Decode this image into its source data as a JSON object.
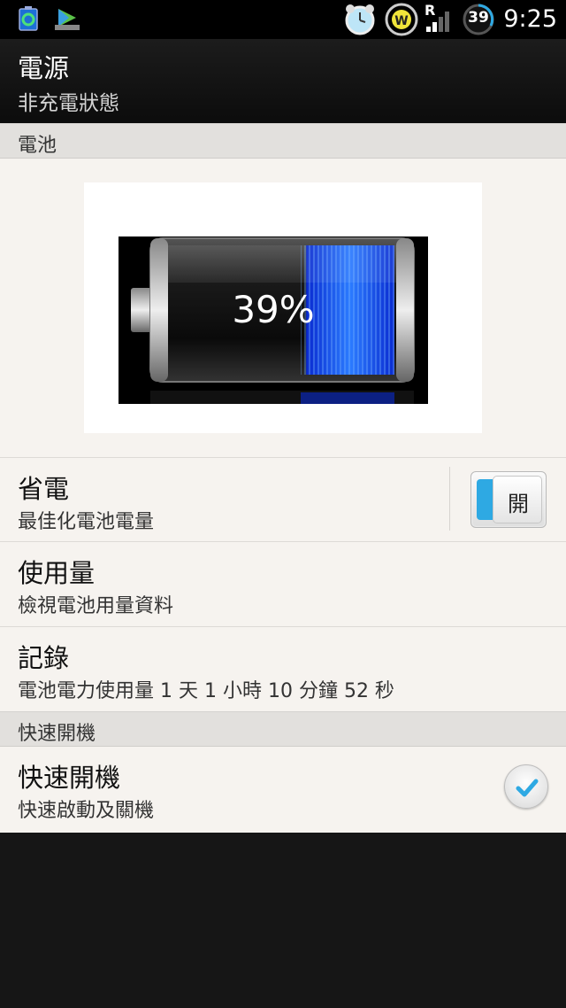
{
  "status_bar": {
    "time": "9:25",
    "network_type": "R",
    "battery_level": "39",
    "icons": [
      "app-recycle-icon",
      "play-store-icon",
      "alarm-clock-icon",
      "wifi-w-icon",
      "signal-icon",
      "battery-ring-icon"
    ]
  },
  "header": {
    "title": "電源",
    "subtitle": "非充電狀態"
  },
  "sections": {
    "battery_header": "電池",
    "fast_boot_header": "快速開機"
  },
  "battery": {
    "percent_label": "39%",
    "level_fraction": 0.39
  },
  "settings": {
    "power_saving": {
      "title": "省電",
      "subtitle": "最佳化電池電量",
      "toggle_label": "開",
      "enabled": true
    },
    "usage": {
      "title": "使用量",
      "subtitle": "檢視電池用量資料"
    },
    "history": {
      "title": "記錄",
      "subtitle": "電池電力使用量 1 天 1 小時 10 分鐘 52 秒"
    },
    "fast_boot": {
      "title": "快速開機",
      "subtitle": "快速啟動及關機",
      "checked": true
    }
  },
  "colors": {
    "accent": "#2ea9e3",
    "content_bg": "#f6f3ef",
    "section_bg": "#e2e0dd",
    "battery_fill": "#1f5cff"
  }
}
